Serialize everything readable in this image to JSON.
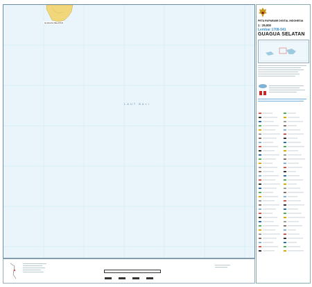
{
  "map": {
    "sea_label": "LAUT BALI",
    "island_label": "GUAGUA SELATAN",
    "water_color": "#e9f5fb",
    "land_color": "#f4d97a",
    "grid_color": "#a9d6ea",
    "corner_coords": {
      "top_left": "",
      "top_right": ""
    }
  },
  "title_block": {
    "series": "PETA RUPABUMI DIGITAL INDONESIA",
    "scale": "1 : 25.000",
    "sheet": "Lembar 1708-541",
    "name": "GUAGUA SELATAN",
    "edition": ""
  },
  "legend": {
    "heading": ""
  },
  "bottom": {
    "scale_text": "",
    "scale_label_color": "#e0a800"
  },
  "colors": {
    "accent": "#3e8ec7",
    "frame": "#6f8fa5"
  }
}
